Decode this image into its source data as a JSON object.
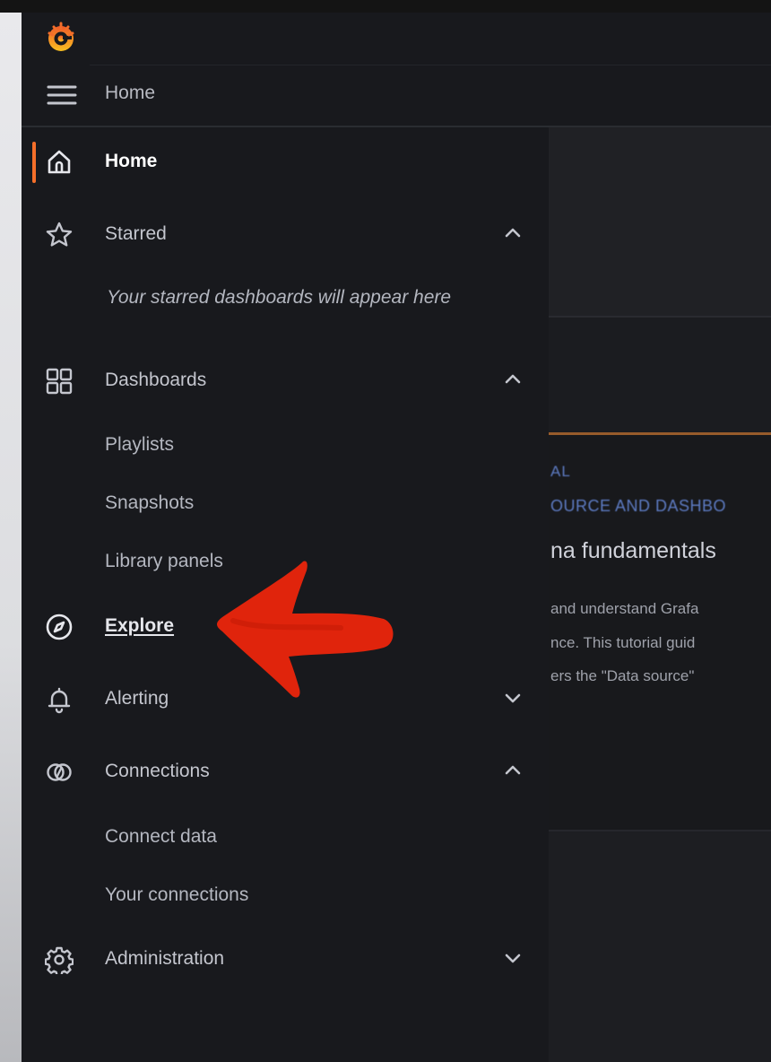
{
  "topbar": {
    "breadcrumb": "Home"
  },
  "sidebar": {
    "home": "Home",
    "starred": "Starred",
    "starred_empty": "Your starred dashboards will appear here",
    "dashboards": "Dashboards",
    "dashboards_children": [
      "Playlists",
      "Snapshots",
      "Library panels"
    ],
    "explore": "Explore",
    "alerting": "Alerting",
    "connections": "Connections",
    "connections_children": [
      "Connect data",
      "Your connections"
    ],
    "administration": "Administration"
  },
  "main_partial": {
    "tag": "AL",
    "subtag": "OURCE AND DASHBO",
    "heading": "na fundamentals",
    "body": [
      "and understand Grafa",
      "nce. This tutorial guid",
      "ers the \"Data source\""
    ]
  },
  "colors": {
    "accent": "#f56f2a",
    "annotation_arrow": "#e0240c",
    "sidebar_bg": "#18191d"
  },
  "icons": [
    "grafana-logo-icon",
    "menu-icon",
    "home-icon",
    "star-icon",
    "chevron-up-icon",
    "apps-icon",
    "compass-icon",
    "bell-icon",
    "chevron-down-icon",
    "link-icon",
    "gear-icon",
    "red-arrow-annotation"
  ]
}
